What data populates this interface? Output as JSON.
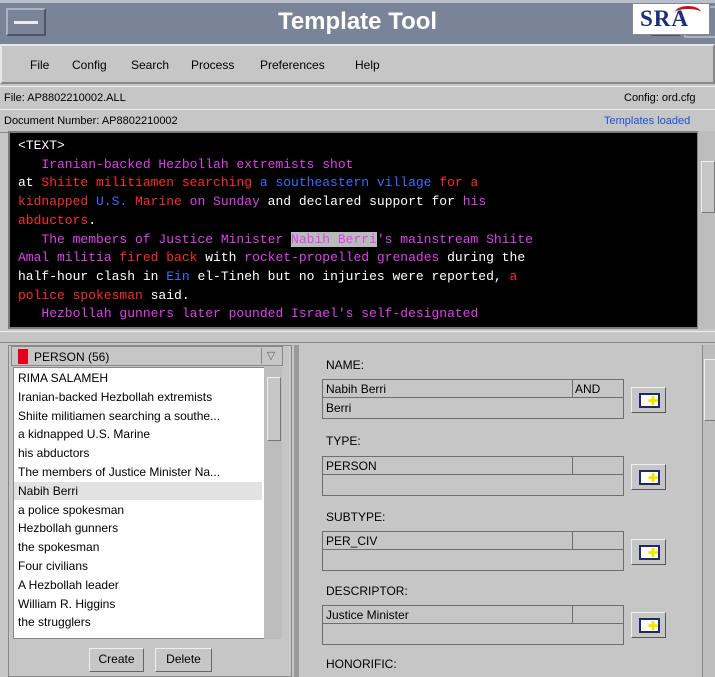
{
  "window": {
    "title": "Template Tool"
  },
  "menu": [
    "File",
    "Config",
    "Search",
    "Process",
    "Preferences",
    "Help"
  ],
  "logo": {
    "text": "SRA",
    "icon": "sra-logo"
  },
  "info": {
    "file": "File: AP8802210002.ALL",
    "config": "Config: ord.cfg",
    "docnum": "Document Number: AP8802210002",
    "status": "Templates loaded"
  },
  "document_lines": [
    [
      {
        "t": "<TEXT>",
        "c": "w"
      }
    ],
    [
      {
        "t": "   Iranian-backed Hezbollah extremists shot",
        "c": "m"
      }
    ],
    [
      {
        "t": "at ",
        "c": "w"
      },
      {
        "t": "Shiite militiamen searching",
        "c": "r"
      },
      {
        "t": " a southeastern village",
        "c": "b"
      },
      {
        "t": " for a",
        "c": "r"
      }
    ],
    [
      {
        "t": "kidnapped ",
        "c": "r"
      },
      {
        "t": "U.S.",
        "c": "b"
      },
      {
        "t": " Marine ",
        "c": "r"
      },
      {
        "t": "on Sunday",
        "c": "m"
      },
      {
        "t": " and declared support for ",
        "c": "w"
      },
      {
        "t": "his",
        "c": "m"
      }
    ],
    [
      {
        "t": "abductors",
        "c": "r"
      },
      {
        "t": ".",
        "c": "w"
      }
    ],
    [
      {
        "t": "   The members of Justice Minister ",
        "c": "m"
      },
      {
        "t": "Nabih Berri",
        "c": "hl"
      },
      {
        "t": "'s mainstream Shiite",
        "c": "m"
      }
    ],
    [
      {
        "t": "Amal militia",
        "c": "m"
      },
      {
        "t": " fired back ",
        "c": "r"
      },
      {
        "t": "with ",
        "c": "w"
      },
      {
        "t": "rocket-propelled grenades",
        "c": "m"
      },
      {
        "t": " during the",
        "c": "w"
      }
    ],
    [
      {
        "t": "half-hour clash in ",
        "c": "w"
      },
      {
        "t": "Ein",
        "c": "b"
      },
      {
        "t": " el-Tineh but no injuries were reported, ",
        "c": "w"
      },
      {
        "t": "a",
        "c": "r"
      }
    ],
    [
      {
        "t": "police spokesman",
        "c": "r"
      },
      {
        "t": " said.",
        "c": "w"
      }
    ],
    [
      {
        "t": "   Hezbollah gunners later pounded Israel's self-designated",
        "c": "m"
      }
    ]
  ],
  "entity_type": {
    "label": "PERSON (56)",
    "color": "#e4001c"
  },
  "entities": [
    "RIMA SALAMEH",
    "Iranian-backed Hezbollah extremists",
    "Shiite militiamen searching a southe...",
    "a kidnapped U.S. Marine",
    "his abductors",
    "The members of Justice Minister Na...",
    "Nabih Berri",
    "a police spokesman",
    "Hezbollah gunners",
    "the spokesman",
    "Four civilians",
    "A Hezbollah leader",
    "William R. Higgins",
    "the strugglers"
  ],
  "selected_entity": "Nabih Berri",
  "buttons": {
    "create": "Create",
    "delete": "Delete"
  },
  "fields": {
    "name": {
      "label": "NAME:",
      "row1": "Nabih Berri",
      "tag": "AND",
      "row2": "Berri"
    },
    "type": {
      "label": "TYPE:",
      "row1": "PERSON",
      "row2": ""
    },
    "subtype": {
      "label": "SUBTYPE:",
      "row1": "PER_CIV",
      "row2": ""
    },
    "descriptor": {
      "label": "DESCRIPTOR:",
      "row1": "Justice Minister",
      "row2": ""
    },
    "honorific": {
      "label": "HONORIFIC:"
    }
  },
  "icons": {
    "edit_button": "edit-document-icon"
  }
}
